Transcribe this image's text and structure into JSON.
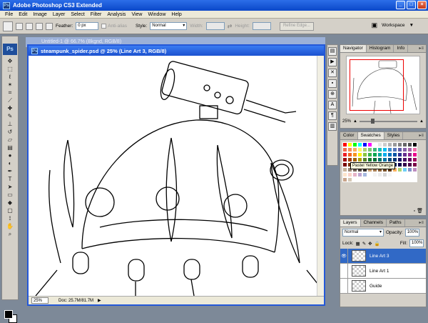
{
  "app": {
    "title": "Adobe Photoshop CS3 Extended",
    "window_buttons": [
      "_",
      "□",
      "×"
    ]
  },
  "menu": [
    "File",
    "Edit",
    "Image",
    "Layer",
    "Select",
    "Filter",
    "Analysis",
    "View",
    "Window",
    "Help"
  ],
  "options_bar": {
    "feather_label": "Feather:",
    "feather_value": "0 px",
    "antialias_label": "Anti-alias",
    "style_label": "Style:",
    "style_value": "Normal",
    "width_label": "Width:",
    "height_label": "Height:",
    "refine_edge": "Refine Edge...",
    "workspace_label": "Workspace"
  },
  "background_doc_title": "Untitled-1 @ 66.7% (Bkgnd, RGB/8)",
  "document": {
    "title": "steampunk_spider.psd @ 25% (Line Art 3, RGB/8)",
    "zoom": "25%",
    "doc_info": "Doc: 25.7M/81.7M"
  },
  "navigator": {
    "tabs": [
      "Navigator",
      "Histogram",
      "Info"
    ],
    "zoom": "25%"
  },
  "swatches": {
    "tabs": [
      "Color",
      "Swatches",
      "Styles"
    ],
    "tooltip": "Pastel Yellow Orange",
    "colors": [
      "#ff0000",
      "#ffff00",
      "#00ff00",
      "#00ffff",
      "#0000ff",
      "#ff00ff",
      "#ffffff",
      "#e6e6e6",
      "#cccccc",
      "#b3b3b3",
      "#999999",
      "#808080",
      "#666666",
      "#4d4d4d",
      "#000000",
      "#f26c4f",
      "#f68e56",
      "#fbaf5d",
      "#fff568",
      "#acd372",
      "#7cc576",
      "#3bb878",
      "#1abbb4",
      "#00bff3",
      "#438ccb",
      "#5574b9",
      "#605ca8",
      "#855fa8",
      "#a763a8",
      "#f06ea9",
      "#ed1c24",
      "#f26522",
      "#f7941d",
      "#fff200",
      "#8dc63f",
      "#39b54a",
      "#00a651",
      "#00a99d",
      "#00aeef",
      "#0072bc",
      "#0054a6",
      "#2e3192",
      "#662d91",
      "#92278f",
      "#ec008c",
      "#9e0b0f",
      "#a0410d",
      "#a3620a",
      "#aba000",
      "#598527",
      "#197b30",
      "#007236",
      "#00746b",
      "#0076a3",
      "#004a80",
      "#003471",
      "#1b1464",
      "#440e62",
      "#630460",
      "#9e005d",
      "#790000",
      "#7b2e00",
      "#7d4900",
      "#827b00",
      "#406618",
      "#005e20",
      "#005826",
      "#005952",
      "#005b7f",
      "#003663",
      "#002157",
      "#0d004c",
      "#32004b",
      "#4b0049",
      "#7b0046",
      "#c7b299",
      "#998675",
      "#736357",
      "#534741",
      "#37302d",
      "#c69c6d",
      "#a67c52",
      "#8c6239",
      "#754c24",
      "#603913",
      "#fbaf5d",
      "#acd372",
      "#6dcff6",
      "#8493ca",
      "#bd8cbf",
      "#fde5cc",
      "#f9d3c8",
      "#e6b3c8",
      "#bfa6d2",
      "#a5b9e0",
      "#ffffff",
      "#f4f4f4",
      "#ebebeb",
      "#d6d6d6",
      "#f5f5f5",
      "#ffffff",
      "#ffffff",
      "#ffffff",
      "#ffffff",
      "#ffffff",
      "#c8a48a",
      "#d6c8b5",
      "#ffffff",
      "#ffffff",
      "#ffffff",
      "#ffffff",
      "#ffffff",
      "#ffffff",
      "#ffffff",
      "#ffffff",
      "#ffffff",
      "#ffffff",
      "#ffffff",
      "#ffffff",
      "#ffffff"
    ]
  },
  "layers_panel": {
    "tabs": [
      "Layers",
      "Channels",
      "Paths"
    ],
    "blend_mode": "Normal",
    "opacity_label": "Opacity:",
    "opacity_value": "100%",
    "lock_label": "Lock:",
    "fill_label": "Fill:",
    "fill_value": "100%",
    "layers": [
      {
        "name": "Line Art 3",
        "selected": true,
        "visible": true
      },
      {
        "name": "Line Art 1",
        "selected": false,
        "visible": false
      },
      {
        "name": "Guide",
        "selected": false,
        "visible": false
      }
    ]
  },
  "icons": {
    "eye": "eye-icon",
    "ps_logo": "Ps"
  }
}
